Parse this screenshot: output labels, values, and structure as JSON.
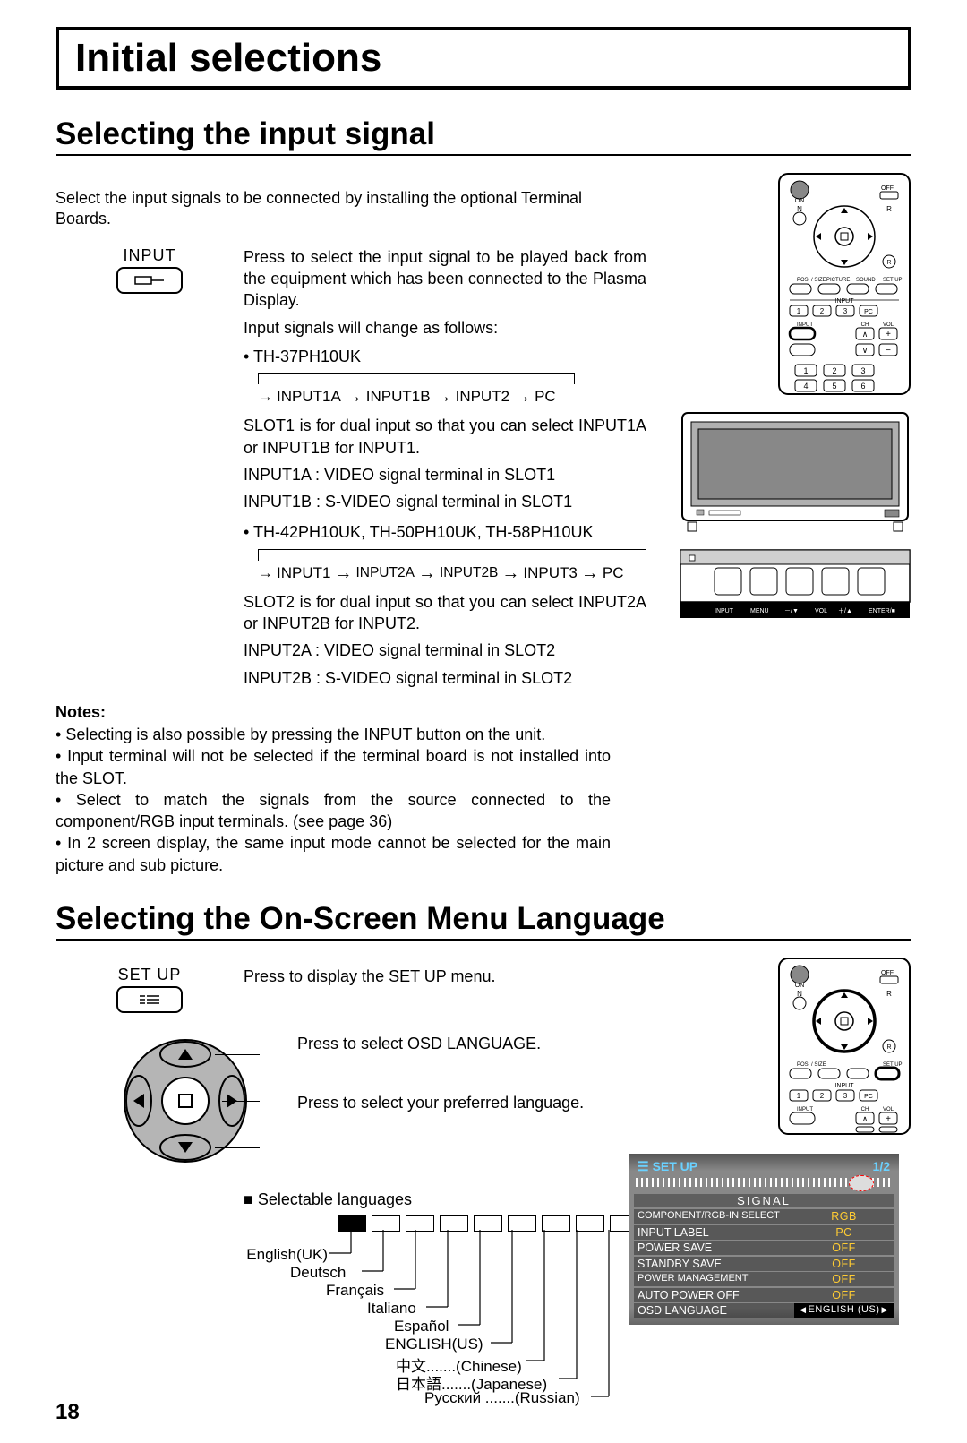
{
  "page_number": "18",
  "title": "Initial selections",
  "section1": {
    "heading": "Selecting the input signal",
    "intro": "Select the input signals to be connected by installing the optional Terminal Boards.",
    "input_label": "INPUT",
    "desc1": "Press to select the input signal to be played back from the equipment which has been connected to the Plasma Display.",
    "desc2": "Input signals will change as follows:",
    "model_a": "• TH-37PH10UK",
    "seq_a_items": [
      "INPUT1A",
      "INPUT1B",
      "INPUT2",
      "PC"
    ],
    "slot1_a": "SLOT1 is for dual input so that you can select INPUT1A or INPUT1B for INPUT1.",
    "slot1_b": "INPUT1A :  VIDEO signal terminal in SLOT1",
    "slot1_c": "INPUT1B :  S-VIDEO signal terminal in SLOT1",
    "model_b": "• TH-42PH10UK, TH-50PH10UK, TH-58PH10UK",
    "seq_b_items": [
      "INPUT1",
      "INPUT2A",
      "INPUT2B",
      "INPUT3",
      "PC"
    ],
    "slot2_a": "SLOT2 is for dual input so that you can select INPUT2A or INPUT2B for INPUT2.",
    "slot2_b": "INPUT2A :  VIDEO signal terminal in SLOT2",
    "slot2_c": "INPUT2B :  S-VIDEO signal terminal in SLOT2"
  },
  "notes": {
    "label": "Notes:",
    "items": [
      "Selecting is also possible by pressing the INPUT button on the unit.",
      "Input terminal will not be selected if the terminal board is not installed into the SLOT.",
      "Select to match the signals from the source connected to the component/RGB input terminals. (see page 36)",
      "In 2 screen display, the same input mode cannot be selected for the main picture and sub picture."
    ]
  },
  "section2": {
    "heading": "Selecting the On-Screen Menu Language",
    "setup_label": "SET UP",
    "step1": "Press to display the SET UP menu.",
    "step2": "Press to select OSD LANGUAGE.",
    "step3": "Press to select your preferred language.",
    "selectable_label": "■ Selectable languages",
    "languages": [
      {
        "label": "English(UK)"
      },
      {
        "label": "Deutsch"
      },
      {
        "label": "Français"
      },
      {
        "label": "Italiano"
      },
      {
        "label": "Español"
      },
      {
        "label": "ENGLISH(US)"
      },
      {
        "label": "中文",
        "suffix": ".......(Chinese)"
      },
      {
        "label": "日本語",
        "suffix": ".......(Japanese)"
      },
      {
        "label": "Русский",
        "suffix": " .......(Russian)"
      }
    ]
  },
  "remote": {
    "on": "ON",
    "off": "OFF",
    "n": "N",
    "r": "R",
    "pos_size": "POS. / SIZE",
    "picture": "PICTURE",
    "sound": "SOUND",
    "setup": "SET UP",
    "input_row": "INPUT",
    "ch": "CH",
    "vol": "VOL",
    "input_btn": "INPUT",
    "pc": "PC",
    "nums1": [
      "1",
      "2",
      "3"
    ],
    "nums2": [
      "4",
      "5",
      "6"
    ],
    "top_nums": [
      "1",
      "2",
      "3"
    ]
  },
  "panel": {
    "labels": [
      "INPUT",
      "MENU",
      "－/▼",
      "VOL",
      "＋/▲",
      "ENTER/■"
    ]
  },
  "osd": {
    "title": "SET UP",
    "page": "1/2",
    "signal": "SIGNAL",
    "rows": [
      {
        "l": "COMPONENT/RGB-IN SELECT",
        "r": "RGB",
        "class": ""
      },
      {
        "l": "INPUT LABEL",
        "r": "PC",
        "class": ""
      },
      {
        "l": "POWER SAVE",
        "r": "OFF",
        "class": ""
      },
      {
        "l": "STANDBY SAVE",
        "r": "OFF",
        "class": ""
      },
      {
        "l": "POWER MANAGEMENT",
        "r": "OFF",
        "class": ""
      },
      {
        "l": "AUTO POWER OFF",
        "r": "OFF",
        "class": ""
      },
      {
        "l": "OSD LANGUAGE",
        "r": "ENGLISH (US)",
        "class": "sel"
      }
    ]
  }
}
